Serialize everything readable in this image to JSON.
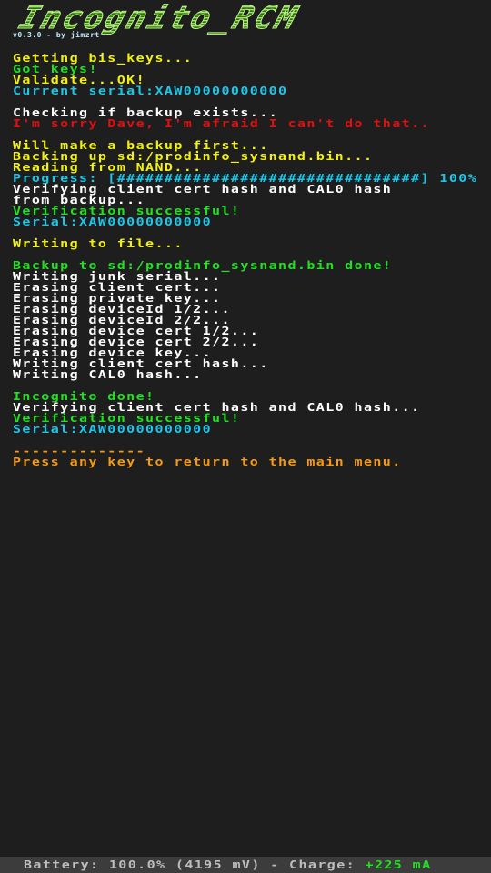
{
  "app": {
    "title": "Incognito_RCM",
    "version": "v0.3.0 - by jimzrt"
  },
  "colors": {
    "background": "#1e1e1e",
    "white": "#ffffff",
    "yellow": "#f2f20e",
    "green": "#22e022",
    "cyan": "#1fc6e8",
    "red": "#e01010",
    "orange": "#f59a13",
    "status_bar": "#3c3c3c"
  },
  "console": {
    "block1": [
      {
        "text": "Getting bis_keys...",
        "color": "yellow"
      },
      {
        "text": "Got keys!",
        "color": "green"
      },
      {
        "text": "Validate...OK!",
        "color": "yellow"
      },
      {
        "text": "Current serial:XAW00000000000",
        "color": "cyan"
      }
    ],
    "block2": [
      {
        "text": "Checking if backup exists...",
        "color": "white"
      },
      {
        "text": "I'm sorry Dave, I'm afraid I can't do that..",
        "color": "red"
      }
    ],
    "block3": [
      {
        "text": "Will make a backup first...",
        "color": "yellow"
      },
      {
        "text": "Backing up sd:/prodinfo_sysnand.bin...",
        "color": "yellow"
      },
      {
        "text": "Reading from NAND...",
        "color": "yellow"
      }
    ],
    "progress": {
      "label": "Progress: [",
      "bar": "################################",
      "suffix": "] 100%",
      "percent": 100
    },
    "block3b": [
      {
        "text": "Verifying client cert hash and CAL0 hash",
        "color": "white"
      },
      {
        "text": "from backup...",
        "color": "white"
      },
      {
        "text": "Verification successful!",
        "color": "green"
      },
      {
        "text": "Serial:XAW00000000000",
        "color": "cyan"
      }
    ],
    "block4": [
      {
        "text": "Writing to file...",
        "color": "yellow"
      }
    ],
    "block5": [
      {
        "text": "Backup to sd:/prodinfo_sysnand.bin done!",
        "color": "green"
      },
      {
        "text": "Writing junk serial...",
        "color": "white"
      },
      {
        "text": "Erasing client cert...",
        "color": "white"
      },
      {
        "text": "Erasing private key...",
        "color": "white"
      },
      {
        "text": "Erasing deviceId 1/2...",
        "color": "white"
      },
      {
        "text": "Erasing deviceId 2/2...",
        "color": "white"
      },
      {
        "text": "Erasing device cert 1/2...",
        "color": "white"
      },
      {
        "text": "Erasing device cert 2/2...",
        "color": "white"
      },
      {
        "text": "Erasing device key...",
        "color": "white"
      },
      {
        "text": "Writing client cert hash...",
        "color": "white"
      },
      {
        "text": "Writing CAL0 hash...",
        "color": "white"
      }
    ],
    "block6": [
      {
        "text": "Incognito done!",
        "color": "green"
      },
      {
        "text": "Verifying client cert hash and CAL0 hash...",
        "color": "white"
      },
      {
        "text": "Verification successful!",
        "color": "green"
      },
      {
        "text": "Serial:XAW00000000000",
        "color": "cyan"
      }
    ],
    "block7": [
      {
        "text": "--------------",
        "color": "orange"
      },
      {
        "text": "Press any key to return to the main menu.",
        "color": "orange"
      }
    ]
  },
  "status": {
    "battery_label": "Battery: 100.0% (4195 mV) - Charge: ",
    "charge_value": "+225 mA"
  }
}
